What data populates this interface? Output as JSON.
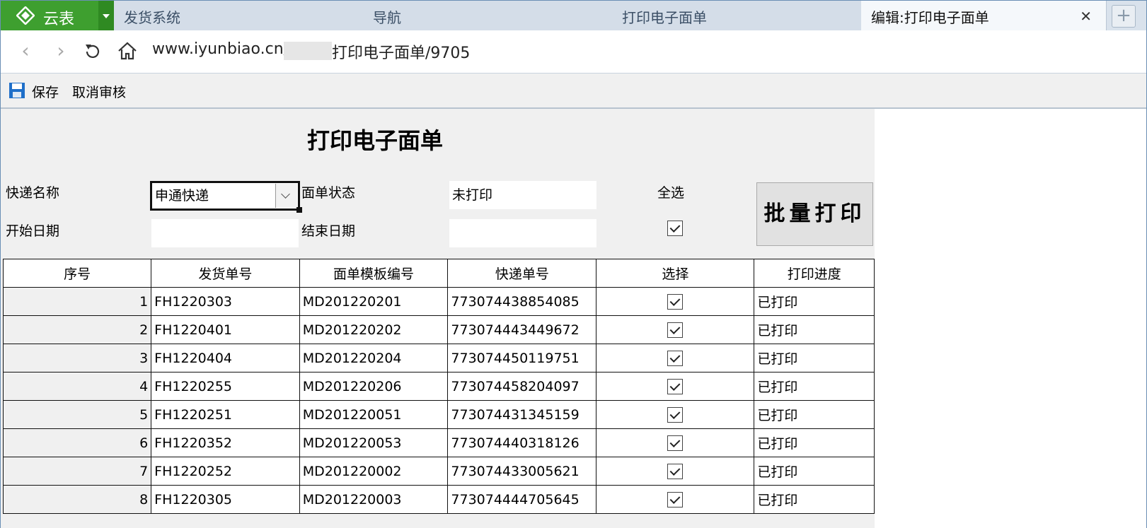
{
  "browser": {
    "brand": "云表",
    "tabs": [
      {
        "label": "发货系统"
      },
      {
        "label": "导航"
      },
      {
        "label": "打印电子面单"
      },
      {
        "label": "编辑:打印电子面单",
        "active": true
      }
    ],
    "url_prefix": "www.iyunbiao.cn/1",
    "url_suffix": "打印电子面单/9705"
  },
  "toolbar": {
    "save_label": "保存",
    "cancel_audit_label": "取消审核"
  },
  "form": {
    "title": "打印电子面单",
    "courier_label": "快递名称",
    "courier_value": "申通快递",
    "status_label": "面单状态",
    "status_value": "未打印",
    "select_all_label": "全选",
    "select_all_checked": true,
    "start_date_label": "开始日期",
    "start_date_value": "",
    "end_date_label": "结束日期",
    "end_date_value": "",
    "batch_print_label": "批量打印"
  },
  "table": {
    "headers": [
      "序号",
      "发货单号",
      "面单模板编号",
      "快递单号",
      "选择",
      "打印进度"
    ],
    "rows": [
      {
        "no": "1",
        "ship_no": "FH1220303",
        "template_no": "MD201220201",
        "tracking_no": "773074438854085",
        "selected": true,
        "progress": "已打印"
      },
      {
        "no": "2",
        "ship_no": "FH1220401",
        "template_no": "MD201220202",
        "tracking_no": "773074443449672",
        "selected": true,
        "progress": "已打印"
      },
      {
        "no": "3",
        "ship_no": "FH1220404",
        "template_no": "MD201220204",
        "tracking_no": "773074450119751",
        "selected": true,
        "progress": "已打印"
      },
      {
        "no": "4",
        "ship_no": "FH1220255",
        "template_no": "MD201220206",
        "tracking_no": "773074458204097",
        "selected": true,
        "progress": "已打印"
      },
      {
        "no": "5",
        "ship_no": "FH1220251",
        "template_no": "MD201220051",
        "tracking_no": "773074431345159",
        "selected": true,
        "progress": "已打印"
      },
      {
        "no": "6",
        "ship_no": "FH1220352",
        "template_no": "MD201220053",
        "tracking_no": "773074440318126",
        "selected": true,
        "progress": "已打印"
      },
      {
        "no": "7",
        "ship_no": "FH1220252",
        "template_no": "MD201220002",
        "tracking_no": "773074433005621",
        "selected": true,
        "progress": "已打印"
      },
      {
        "no": "8",
        "ship_no": "FH1220305",
        "template_no": "MD201220003",
        "tracking_no": "773074444705645",
        "selected": true,
        "progress": "已打印"
      }
    ]
  },
  "colors": {
    "brand_green": "#3e9f2f",
    "tab_bar": "#d9e2ec",
    "form_bg": "#f0f0f0"
  }
}
